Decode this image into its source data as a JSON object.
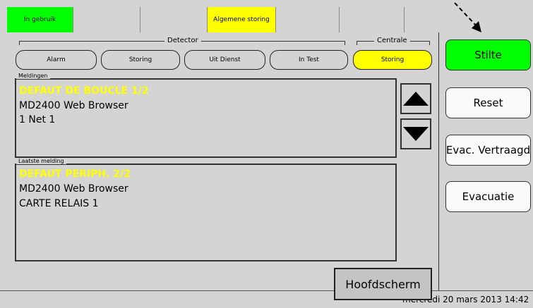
{
  "top_status": {
    "cell_1": "In gebruik",
    "cell_2": "",
    "cell_3": "",
    "cell_4": "Algemene storing",
    "cell_5": "",
    "cell_6": "",
    "cell_7": ""
  },
  "groups": {
    "detector_label": "Detector",
    "centrale_label": "Centrale"
  },
  "filters": {
    "alarm": "Alarm",
    "storing": "Storing",
    "uit_dienst": "Uit Dienst",
    "in_test": "In Test",
    "centrale_storing": "Storing"
  },
  "meldingen": {
    "legend": "Meldingen",
    "line_1": "DEFAUT DE BOUCLE 1/2",
    "line_2": "MD2400 Web Browser",
    "line_3": "1 Net 1"
  },
  "laatste": {
    "legend": "Laatste melding",
    "line_1": "DEFAUT PERIPH. 2/2",
    "line_2": "MD2400 Web Browser",
    "line_3": "CARTE RELAIS 1"
  },
  "buttons": {
    "hoofdscherm": "Hoofdscherm",
    "stilte": "Stilte",
    "reset": "Reset",
    "evac_vertraagd": "Evac. Vertraagd",
    "evacuatie": "Evacuatie"
  },
  "footer": {
    "datetime": "mercredi 20 mars 2013 14:42"
  },
  "colors": {
    "green": "#00ff00",
    "yellow": "#ffff00",
    "panel": "#d4d4d4"
  },
  "icons": {
    "scroll_up": "triangle-up-icon",
    "scroll_down": "triangle-down-icon",
    "pointer_arrow": "dashed-arrow-icon"
  }
}
